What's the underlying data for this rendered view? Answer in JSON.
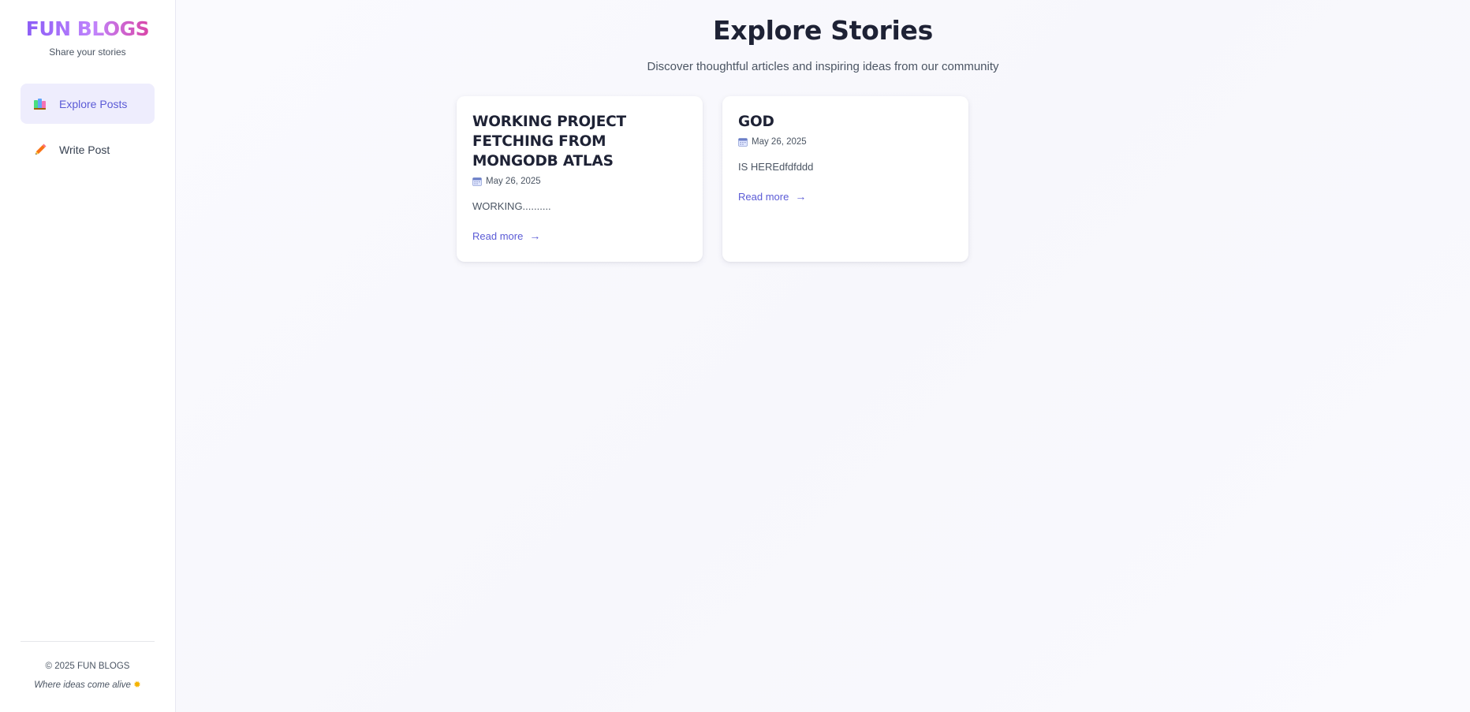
{
  "brand": {
    "title": "FUN BLOGS",
    "subtitle": "Share your stories"
  },
  "nav": {
    "items": [
      {
        "label": "Explore Posts",
        "icon": "books-icon",
        "active": true
      },
      {
        "label": "Write Post",
        "icon": "pencil-icon",
        "active": false
      }
    ]
  },
  "footer": {
    "copyright": "© 2025 FUN BLOGS",
    "tagline": "Where ideas come alive",
    "tagline_emoji": "✹"
  },
  "header": {
    "title": "Explore Stories",
    "subtitle": "Discover thoughtful articles and inspiring ideas from our community"
  },
  "posts": [
    {
      "title": "WORKING PROJECT FETCHING FROM MONGODB ATLAS",
      "date": "May 26, 2025",
      "excerpt": "WORKING..........",
      "link": "Read more",
      "arrow": "→"
    },
    {
      "title": "GOD",
      "date": "May 26, 2025",
      "excerpt": "IS HEREdfdfddd",
      "link": "Read more",
      "arrow": "→"
    }
  ],
  "colors": {
    "accent": "#5b5bd6",
    "active_bg": "#eeedfd",
    "brand_gradient_start": "#8b5cf6",
    "brand_gradient_end": "#d946a8"
  }
}
